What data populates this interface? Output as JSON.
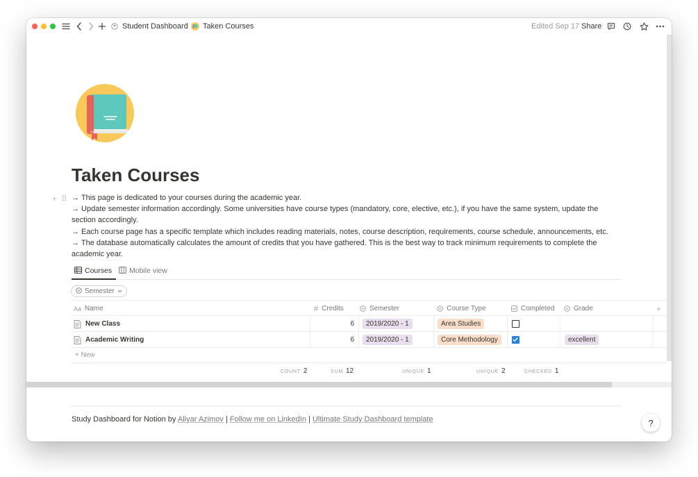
{
  "breadcrumb": {
    "parent": "Student Dashboard",
    "separator": "/",
    "current": "Taken Courses"
  },
  "topbar": {
    "edited": "Edited Sep 17",
    "share": "Share",
    "icons": [
      "sidebar-menu-icon",
      "back-arrow-icon",
      "forward-arrow-icon",
      "add-icon",
      "comment-icon",
      "history-icon",
      "favorite-star-icon",
      "more-icon"
    ]
  },
  "page": {
    "icon": "book-icon",
    "title": "Taken Courses",
    "description": [
      "→ This page is dedicated to your courses during the academic year.",
      "→ Update semester information accordingly. Some universities have course types (mandatory, core, elective, etc.), if you have the same system, update the section accordingly.",
      "→ Each course page has a specific template which includes reading materials, notes, course description, requirements, course schedule, announcements, etc.",
      "→ The database automatically calculates the amount of credits that you have gathered. This is the best way to track minimum requirements to complete the academic year."
    ]
  },
  "views": {
    "tabs": [
      {
        "label": "Courses",
        "icon": "table-icon",
        "active": true
      },
      {
        "label": "Mobile view",
        "icon": "board-icon",
        "active": false
      }
    ],
    "filter": "Semester"
  },
  "table": {
    "columns": [
      {
        "label": "Name",
        "icon": "Aa"
      },
      {
        "label": "Credits",
        "icon": "#"
      },
      {
        "label": "Semester",
        "icon": "select-icon"
      },
      {
        "label": "Course Type",
        "icon": "select-icon"
      },
      {
        "label": "Completed",
        "icon": "checkbox-icon"
      },
      {
        "label": "Grade",
        "icon": "select-icon"
      }
    ],
    "rows": [
      {
        "name": "New Class",
        "credits": "6",
        "semester": "2019/2020 - 1",
        "course_type": "Area Studies",
        "completed": false,
        "grade": ""
      },
      {
        "name": "Academic Writing",
        "credits": "6",
        "semester": "2019/2020 - 1",
        "course_type": "Core Methodology",
        "completed": true,
        "grade": "excellent"
      }
    ],
    "new_label": "+ New",
    "calculations": {
      "name": {
        "label": "COUNT",
        "value": "2"
      },
      "credits": {
        "label": "SUM",
        "value": "12"
      },
      "semester": {
        "label": "UNIQUE",
        "value": "1"
      },
      "course_type": {
        "label": "UNIQUE",
        "value": "2"
      },
      "completed": {
        "label": "CHECKED",
        "value": "1"
      }
    },
    "tag_colors": {
      "purple": "#e8deee",
      "orange": "#fadec9"
    }
  },
  "footer": {
    "prefix": "Study Dashboard for Notion by",
    "author": "Aliyar Azimov",
    "sep1": "|",
    "linkedin": "Follow me on LinkedIn",
    "sep2": "|",
    "template": "Ultimate Study Dashboard template"
  },
  "help": "?"
}
